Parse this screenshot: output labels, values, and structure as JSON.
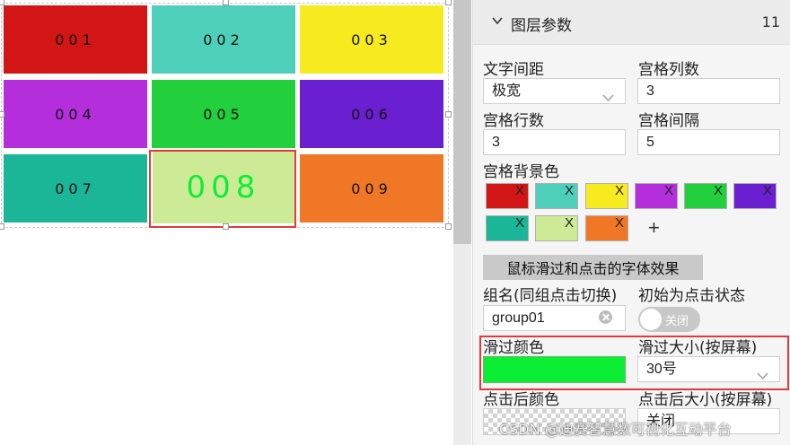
{
  "grid": {
    "cells": [
      {
        "label": "001",
        "color": "#d21515"
      },
      {
        "label": "002",
        "color": "#4ecfb9"
      },
      {
        "label": "003",
        "color": "#f7ea1e"
      },
      {
        "label": "004",
        "color": "#b52edc"
      },
      {
        "label": "005",
        "color": "#21d03c"
      },
      {
        "label": "006",
        "color": "#6a1fd0"
      },
      {
        "label": "007",
        "color": "#1bb597"
      },
      {
        "label": "008",
        "color": "#cdeb96"
      },
      {
        "label": "009",
        "color": "#f07726"
      }
    ],
    "hovered_text_color": "#0cee33"
  },
  "panel": {
    "header": {
      "title": "图层参数",
      "count": "11"
    },
    "text_spacing": {
      "label": "文字间距",
      "value": "极宽"
    },
    "columns": {
      "label": "宫格列数",
      "value": "3"
    },
    "rows": {
      "label": "宫格行数",
      "value": "3"
    },
    "gap": {
      "label": "宫格间隔",
      "value": "5"
    },
    "bg_colors": {
      "label": "宫格背景色",
      "remove_mark": "X",
      "add": "+",
      "swatches": [
        "#d21515",
        "#4ecfb9",
        "#f7ea1e",
        "#b52edc",
        "#21d03c",
        "#6a1fd0",
        "#1bb597",
        "#cdeb96",
        "#f07726"
      ]
    },
    "section_title": "鼠标滑过和点击的字体效果",
    "group_name": {
      "label": "组名(同组点击切换)",
      "value": "group01"
    },
    "initial_click": {
      "label": "初始为点击状态",
      "toggle_text": "关闭"
    },
    "hover_color": {
      "label": "滑过颜色",
      "value": "#0cee33"
    },
    "hover_size": {
      "label": "滑过大小(按屏幕)",
      "value": "30号"
    },
    "click_color": {
      "label": "点击后颜色"
    },
    "click_size": {
      "label": "点击后大小(按屏幕)",
      "value": "关闭"
    }
  },
  "watermark": "CSDN @迪赛智慧数可视化互动平台"
}
